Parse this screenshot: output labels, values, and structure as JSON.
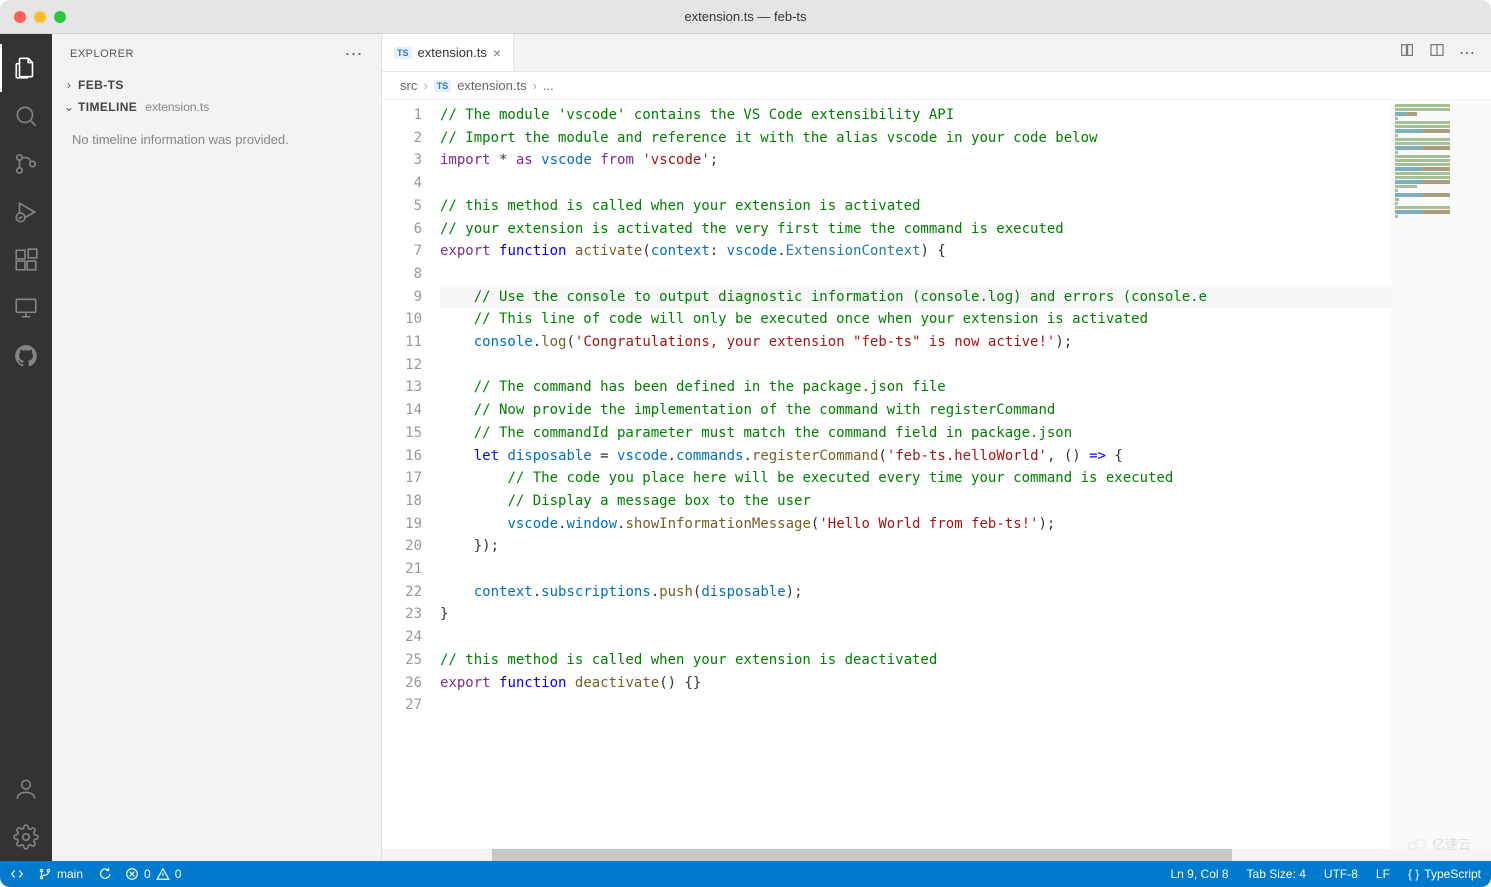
{
  "window": {
    "title": "extension.ts — feb-ts"
  },
  "explorer": {
    "title": "EXPLORER",
    "folder": "FEB-TS",
    "timeline_label": "TIMELINE",
    "timeline_file": "extension.ts",
    "timeline_msg": "No timeline information was provided."
  },
  "tab": {
    "name": "extension.ts",
    "lang_badge": "TS"
  },
  "breadcrumb": {
    "seg1": "src",
    "seg2": "extension.ts",
    "seg3": "...",
    "badge": "TS"
  },
  "code_lines": [
    {
      "n": "1",
      "tokens": [
        {
          "c": "cm",
          "t": "// The module 'vscode' contains the VS Code extensibility API"
        }
      ]
    },
    {
      "n": "2",
      "tokens": [
        {
          "c": "cm",
          "t": "// Import the module and reference it with the alias vscode in your code below"
        }
      ]
    },
    {
      "n": "3",
      "tokens": [
        {
          "c": "kw",
          "t": "import"
        },
        {
          "c": "pn",
          "t": " * "
        },
        {
          "c": "kw",
          "t": "as"
        },
        {
          "c": "pn",
          "t": " "
        },
        {
          "c": "va",
          "t": "vscode"
        },
        {
          "c": "pn",
          "t": " "
        },
        {
          "c": "kw",
          "t": "from"
        },
        {
          "c": "pn",
          "t": " "
        },
        {
          "c": "st",
          "t": "'vscode'"
        },
        {
          "c": "pn",
          "t": ";"
        }
      ]
    },
    {
      "n": "4",
      "tokens": []
    },
    {
      "n": "5",
      "tokens": [
        {
          "c": "cm",
          "t": "// this method is called when your extension is activated"
        }
      ]
    },
    {
      "n": "6",
      "tokens": [
        {
          "c": "cm",
          "t": "// your extension is activated the very first time the command is executed"
        }
      ]
    },
    {
      "n": "7",
      "tokens": [
        {
          "c": "kw",
          "t": "export"
        },
        {
          "c": "pn",
          "t": " "
        },
        {
          "c": "kw2",
          "t": "function"
        },
        {
          "c": "pn",
          "t": " "
        },
        {
          "c": "fn",
          "t": "activate"
        },
        {
          "c": "pn",
          "t": "("
        },
        {
          "c": "va",
          "t": "context"
        },
        {
          "c": "pn",
          "t": ": "
        },
        {
          "c": "va",
          "t": "vscode"
        },
        {
          "c": "pn",
          "t": "."
        },
        {
          "c": "ty",
          "t": "ExtensionContext"
        },
        {
          "c": "pn",
          "t": ") {"
        }
      ]
    },
    {
      "n": "8",
      "tokens": []
    },
    {
      "n": "9",
      "highlight": true,
      "tokens": [
        {
          "c": "pn",
          "t": "    "
        },
        {
          "c": "cm",
          "t": "// Use the console to output diagnostic information (console.log) and errors (console.e"
        }
      ]
    },
    {
      "n": "10",
      "tokens": [
        {
          "c": "pn",
          "t": "    "
        },
        {
          "c": "cm",
          "t": "// This line of code will only be executed once when your extension is activated"
        }
      ]
    },
    {
      "n": "11",
      "tokens": [
        {
          "c": "pn",
          "t": "    "
        },
        {
          "c": "va",
          "t": "console"
        },
        {
          "c": "pn",
          "t": "."
        },
        {
          "c": "fn",
          "t": "log"
        },
        {
          "c": "pn",
          "t": "("
        },
        {
          "c": "st",
          "t": "'Congratulations, your extension \"feb-ts\" is now active!'"
        },
        {
          "c": "pn",
          "t": ");"
        }
      ]
    },
    {
      "n": "12",
      "tokens": []
    },
    {
      "n": "13",
      "tokens": [
        {
          "c": "pn",
          "t": "    "
        },
        {
          "c": "cm",
          "t": "// The command has been defined in the package.json file"
        }
      ]
    },
    {
      "n": "14",
      "tokens": [
        {
          "c": "pn",
          "t": "    "
        },
        {
          "c": "cm",
          "t": "// Now provide the implementation of the command with registerCommand"
        }
      ]
    },
    {
      "n": "15",
      "tokens": [
        {
          "c": "pn",
          "t": "    "
        },
        {
          "c": "cm",
          "t": "// The commandId parameter must match the command field in package.json"
        }
      ]
    },
    {
      "n": "16",
      "tokens": [
        {
          "c": "pn",
          "t": "    "
        },
        {
          "c": "kw2",
          "t": "let"
        },
        {
          "c": "pn",
          "t": " "
        },
        {
          "c": "va",
          "t": "disposable"
        },
        {
          "c": "pn",
          "t": " = "
        },
        {
          "c": "va",
          "t": "vscode"
        },
        {
          "c": "pn",
          "t": "."
        },
        {
          "c": "va",
          "t": "commands"
        },
        {
          "c": "pn",
          "t": "."
        },
        {
          "c": "fn",
          "t": "registerCommand"
        },
        {
          "c": "pn",
          "t": "("
        },
        {
          "c": "st",
          "t": "'feb-ts.helloWorld'"
        },
        {
          "c": "pn",
          "t": ", () "
        },
        {
          "c": "kw2",
          "t": "=>"
        },
        {
          "c": "pn",
          "t": " {"
        }
      ]
    },
    {
      "n": "17",
      "tokens": [
        {
          "c": "pn",
          "t": "        "
        },
        {
          "c": "cm",
          "t": "// The code you place here will be executed every time your command is executed"
        }
      ]
    },
    {
      "n": "18",
      "tokens": [
        {
          "c": "pn",
          "t": "        "
        },
        {
          "c": "cm",
          "t": "// Display a message box to the user"
        }
      ]
    },
    {
      "n": "19",
      "tokens": [
        {
          "c": "pn",
          "t": "        "
        },
        {
          "c": "va",
          "t": "vscode"
        },
        {
          "c": "pn",
          "t": "."
        },
        {
          "c": "va",
          "t": "window"
        },
        {
          "c": "pn",
          "t": "."
        },
        {
          "c": "fn",
          "t": "showInformationMessage"
        },
        {
          "c": "pn",
          "t": "("
        },
        {
          "c": "st",
          "t": "'Hello World from feb-ts!'"
        },
        {
          "c": "pn",
          "t": ");"
        }
      ]
    },
    {
      "n": "20",
      "tokens": [
        {
          "c": "pn",
          "t": "    });"
        }
      ]
    },
    {
      "n": "21",
      "tokens": []
    },
    {
      "n": "22",
      "tokens": [
        {
          "c": "pn",
          "t": "    "
        },
        {
          "c": "va",
          "t": "context"
        },
        {
          "c": "pn",
          "t": "."
        },
        {
          "c": "va",
          "t": "subscriptions"
        },
        {
          "c": "pn",
          "t": "."
        },
        {
          "c": "fn",
          "t": "push"
        },
        {
          "c": "pn",
          "t": "("
        },
        {
          "c": "va",
          "t": "disposable"
        },
        {
          "c": "pn",
          "t": ");"
        }
      ]
    },
    {
      "n": "23",
      "tokens": [
        {
          "c": "pn",
          "t": "}"
        }
      ]
    },
    {
      "n": "24",
      "tokens": []
    },
    {
      "n": "25",
      "tokens": [
        {
          "c": "cm",
          "t": "// this method is called when your extension is deactivated"
        }
      ]
    },
    {
      "n": "26",
      "tokens": [
        {
          "c": "kw",
          "t": "export"
        },
        {
          "c": "pn",
          "t": " "
        },
        {
          "c": "kw2",
          "t": "function"
        },
        {
          "c": "pn",
          "t": " "
        },
        {
          "c": "fn",
          "t": "deactivate"
        },
        {
          "c": "pn",
          "t": "() {}"
        }
      ]
    },
    {
      "n": "27",
      "tokens": []
    }
  ],
  "status": {
    "remote": "",
    "branch": "main",
    "sync": "",
    "errors": "0",
    "warnings": "0",
    "lncol": "Ln 9, Col 8",
    "spaces": "Tab Size: 4",
    "encoding": "UTF-8",
    "eol": "LF",
    "lang": "TypeScript"
  },
  "watermark": "亿速云"
}
